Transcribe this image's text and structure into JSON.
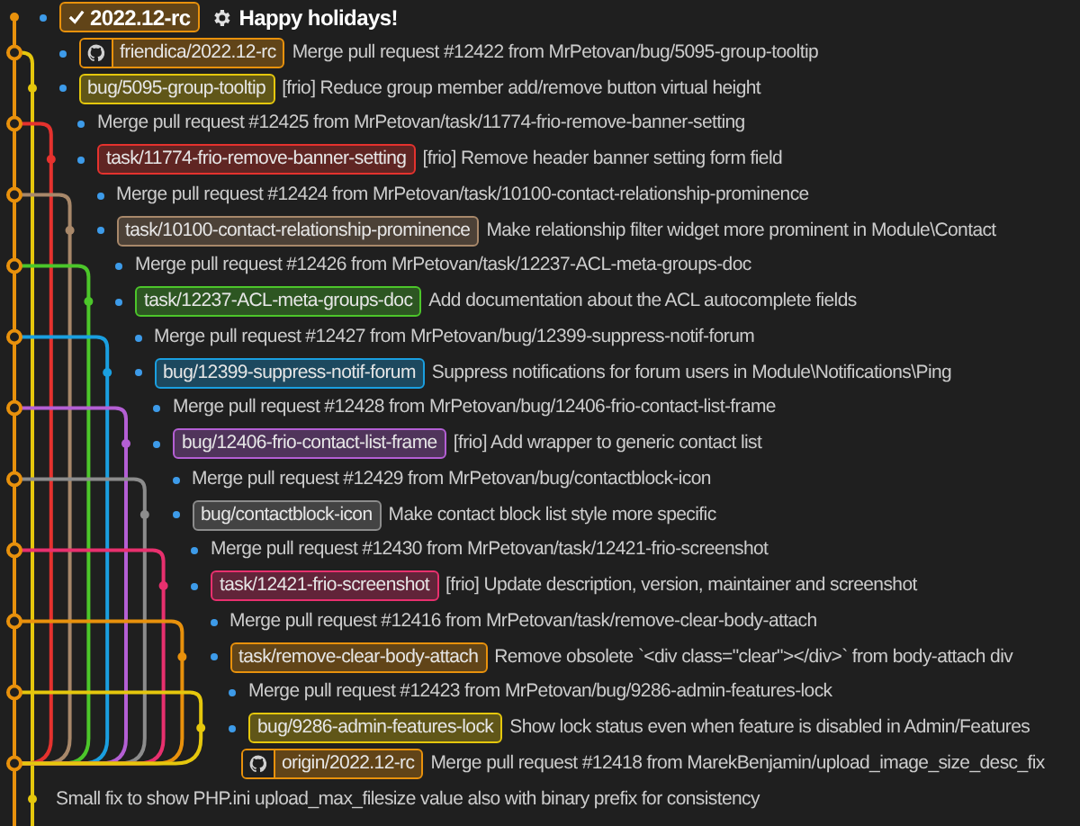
{
  "rows": [
    {
      "kind": "head",
      "refs": [
        {
          "label": "2022.12-rc",
          "color": "#e8910c"
        }
      ],
      "message": "Happy holidays!"
    },
    {
      "kind": "merge",
      "refs": [
        {
          "label": "friendica/2022.12-rc",
          "color": "#e8910c"
        }
      ],
      "message": "Merge pull request #12422 from MrPetovan/bug/5095-group-tooltip"
    },
    {
      "kind": "branch",
      "refs": [
        {
          "label": "bug/5095-group-tooltip",
          "color": "#e5c70d"
        }
      ],
      "message": "[frio] Reduce group member add/remove button virtual height"
    },
    {
      "kind": "merge",
      "refs": [],
      "message": "Merge pull request #12425 from MrPetovan/task/11774-frio-remove-banner-setting"
    },
    {
      "kind": "branch",
      "refs": [
        {
          "label": "task/11774-frio-remove-banner-setting",
          "color": "#e5322e"
        }
      ],
      "message": "[frio] Remove header banner setting form field"
    },
    {
      "kind": "merge",
      "refs": [],
      "message": "Merge pull request #12424 from MrPetovan/task/10100-contact-relationship-prominence"
    },
    {
      "kind": "branch",
      "refs": [
        {
          "label": "task/10100-contact-relationship-prominence",
          "color": "#a8886a"
        }
      ],
      "message": "Make relationship filter widget more prominent in Module\\Contact"
    },
    {
      "kind": "merge",
      "refs": [],
      "message": "Merge pull request #12426 from MrPetovan/task/12237-ACL-meta-groups-doc"
    },
    {
      "kind": "branch",
      "refs": [
        {
          "label": "task/12237-ACL-meta-groups-doc",
          "color": "#4cc62a"
        }
      ],
      "message": "Add documentation about the ACL autocomplete fields"
    },
    {
      "kind": "merge",
      "refs": [],
      "message": "Merge pull request #12427 from MrPetovan/bug/12399-suppress-notif-forum"
    },
    {
      "kind": "branch",
      "refs": [
        {
          "label": "bug/12399-suppress-notif-forum",
          "color": "#1a9fe0"
        }
      ],
      "message": "Suppress notifications for forum users in Module\\Notifications\\Ping"
    },
    {
      "kind": "merge",
      "refs": [],
      "message": "Merge pull request #12428 from MrPetovan/bug/12406-frio-contact-list-frame"
    },
    {
      "kind": "branch",
      "refs": [
        {
          "label": "bug/12406-frio-contact-list-frame",
          "color": "#b45fd4"
        }
      ],
      "message": "[frio] Add wrapper to generic contact list"
    },
    {
      "kind": "merge",
      "refs": [],
      "message": "Merge pull request #12429 from MrPetovan/bug/contactblock-icon"
    },
    {
      "kind": "branch",
      "refs": [
        {
          "label": "bug/contactblock-icon",
          "color": "#8c8c8c"
        }
      ],
      "message": "Make contact block list style more specific"
    },
    {
      "kind": "merge",
      "refs": [],
      "message": "Merge pull request #12430 from MrPetovan/task/12421-frio-screenshot"
    },
    {
      "kind": "branch",
      "refs": [
        {
          "label": "task/12421-frio-screenshot",
          "color": "#e8306e"
        }
      ],
      "message": "[frio] Update description, version, maintainer and screenshot"
    },
    {
      "kind": "merge",
      "refs": [],
      "message": "Merge pull request #12416 from MrPetovan/task/remove-clear-body-attach"
    },
    {
      "kind": "branch",
      "refs": [
        {
          "label": "task/remove-clear-body-attach",
          "color": "#e8910c"
        }
      ],
      "message": "Remove obsolete `<div class=\"clear\"></div>` from body-attach div"
    },
    {
      "kind": "merge",
      "refs": [],
      "message": "Merge pull request #12423 from MrPetovan/bug/9286-admin-features-lock"
    },
    {
      "kind": "branch",
      "refs": [
        {
          "label": "bug/9286-admin-features-lock",
          "color": "#e5c70d"
        }
      ],
      "message": "Show lock status even when feature is disabled in Admin/Features"
    },
    {
      "kind": "remote",
      "refs": [
        {
          "label": "origin/2022.12-rc",
          "color": "#e8910c"
        }
      ],
      "message": "Merge pull request #12418 from MarekBenjamin/upload_image_size_desc_fix"
    },
    {
      "kind": "base",
      "refs": [],
      "message": "Small fix to show PHP.ini upload_max_filesize value also with binary prefix for consistency"
    }
  ]
}
